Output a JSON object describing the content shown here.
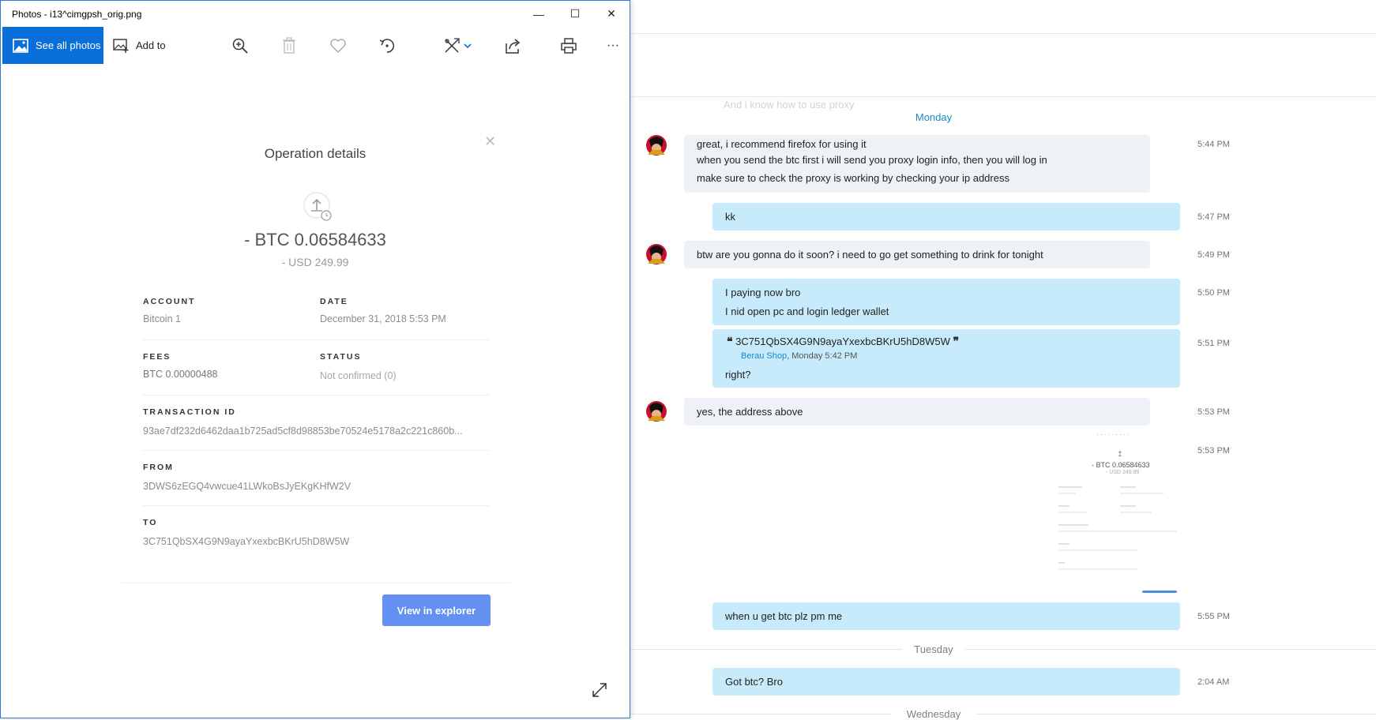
{
  "window": {
    "title": "Photos - i13^cimgpsh_orig.png",
    "minimize_glyph": "—",
    "maximize_glyph": "☐",
    "close_glyph": "✕"
  },
  "toolbar": {
    "see_all_label": "See all photos",
    "add_to_label": "Add to",
    "icons": [
      "zoom-in-icon",
      "delete-icon",
      "heart-icon",
      "rotate-icon",
      "edit-icon",
      "share-icon",
      "print-icon",
      "more-icon"
    ],
    "more_glyph": "···"
  },
  "operation": {
    "title": "Operation details",
    "close_glyph": "✕",
    "amount": "- BTC 0.06584633",
    "usd": "- USD 249.99",
    "fields": {
      "account_label": "ACCOUNT",
      "account_value": "Bitcoin 1",
      "date_label": "DATE",
      "date_value": "December 31, 2018 5:53 PM",
      "fees_label": "FEES",
      "fees_value": "BTC 0.00000488",
      "status_label": "STATUS",
      "status_value": "Not confirmed (0)",
      "txid_label": "TRANSACTION ID",
      "txid_value": "93ae7df232d6462daa1b725ad5cf8d98853be70524e5178a2c221c860b...",
      "from_label": "FROM",
      "from_value": "3DWS6zEGQ4vwcue41LWkoBsJyEKgKHfW2V",
      "to_label": "TO",
      "to_value": "3C751QbSX4G9N9ayaYxexbcBKrU5hD8W5W"
    },
    "explorer_button": "View in explorer"
  },
  "chat": {
    "ghost_message": "And i know how to use proxy",
    "day_monday": "Monday",
    "day_tuesday": "Tuesday",
    "day_wednesday": "Wednesday",
    "messages": [
      {
        "lines": [
          "great, i recommend firefox for using it",
          "when you send the btc first i will send you proxy login info, then you will log in",
          "make sure to check the proxy is working by checking  your ip address"
        ],
        "time": "5:44 PM"
      },
      {
        "lines": [
          "kk"
        ],
        "time": "5:47 PM"
      },
      {
        "lines": [
          "btw are you gonna do it soon? i need to go get something to drink for tonight"
        ],
        "time": "5:49 PM"
      },
      {
        "lines": [
          "I paying now bro",
          "I nid open pc and login ledger wallet"
        ],
        "time": "5:50 PM"
      },
      {
        "quote_text": "3C751QbSX4G9N9ayaYxexbcBKrU5hD8W5W",
        "quote_author": "Berau Shop",
        "quote_meta": ", Monday 5:42 PM",
        "lines": [
          "right?"
        ],
        "time": "5:51 PM"
      },
      {
        "lines": [
          "yes, the address above"
        ],
        "time": "5:53 PM"
      },
      {
        "image": true,
        "time": "5:53 PM"
      },
      {
        "lines": [
          "when u get btc plz pm me"
        ],
        "time": "5:55 PM"
      },
      {
        "lines": [
          "Got btc? Bro"
        ],
        "time": "2:04 AM"
      }
    ],
    "thumb": {
      "amount": "- BTC 0.06584633",
      "usd": "- USD 249.99"
    }
  }
}
